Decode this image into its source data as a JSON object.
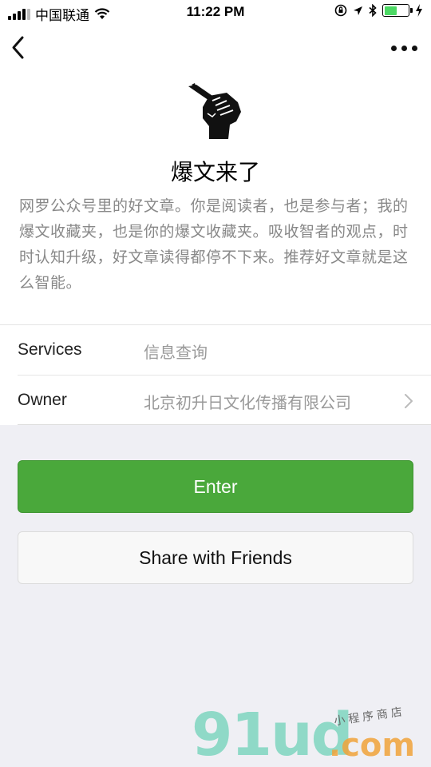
{
  "status_bar": {
    "carrier": "中国联通",
    "time": "11:22 PM",
    "battery_level": 0.55,
    "icons": [
      "signal-icon",
      "wifi-icon",
      "orientation-lock-icon",
      "location-icon",
      "bluetooth-icon",
      "battery-icon",
      "charging-icon"
    ]
  },
  "nav": {
    "back_icon": "chevron-left-icon",
    "more_icon": "more-dots-icon"
  },
  "app": {
    "logo_icon": "fist-pen-icon",
    "name": "爆文来了",
    "description": "网罗公众号里的好文章。你是阅读者，也是参与者；我的爆文收藏夹，也是你的爆文收藏夹。吸收智者的观点，时时认知升级，好文章读得都停不下来。推荐好文章就是这么智能。"
  },
  "info": [
    {
      "label": "Services",
      "value": "信息查询"
    },
    {
      "label": "Owner",
      "value": "北京初升日文化传播有限公司"
    }
  ],
  "buttons": {
    "enter": "Enter",
    "share": "Share with Friends"
  },
  "colors": {
    "primary_green": "#4aa83b",
    "background": "#efeff4"
  },
  "watermark": {
    "main": "91ud",
    "domain": ".com",
    "tagline": "小程序商店"
  }
}
